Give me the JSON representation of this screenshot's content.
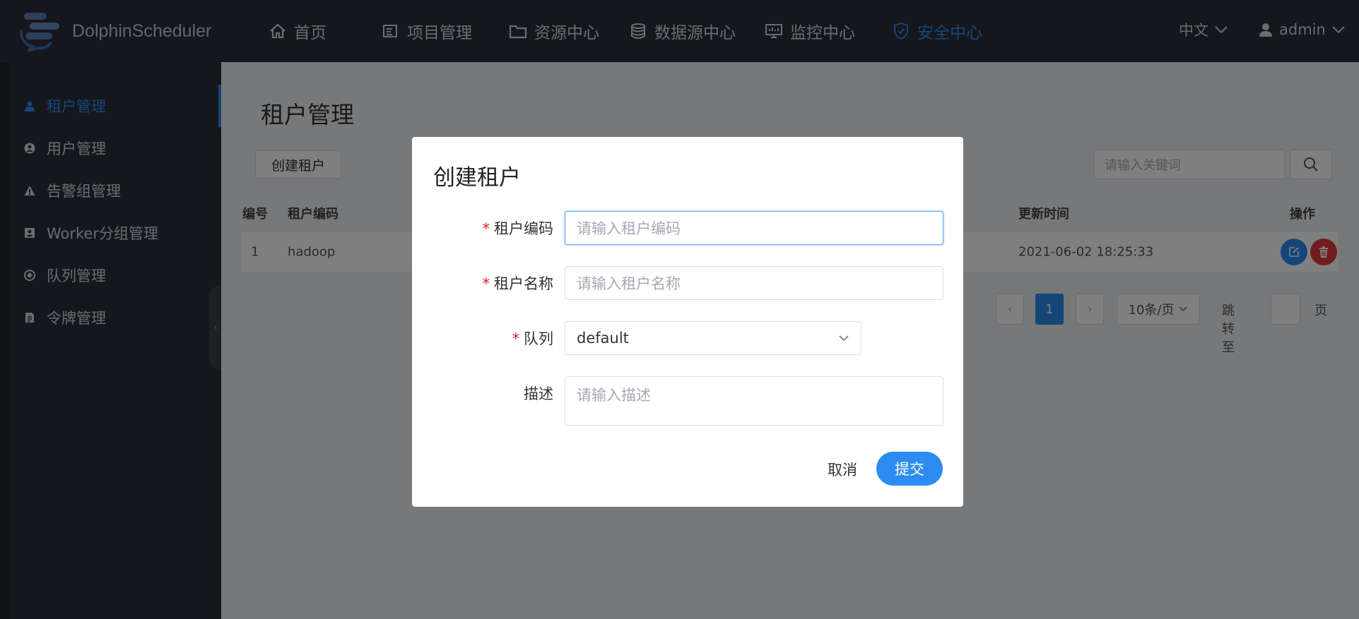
{
  "app": {
    "name": "DolphinScheduler"
  },
  "topnav": {
    "items": [
      {
        "label": "首页",
        "icon": "home-icon"
      },
      {
        "label": "项目管理",
        "icon": "project-icon"
      },
      {
        "label": "资源中心",
        "icon": "folder-icon"
      },
      {
        "label": "数据源中心",
        "icon": "database-icon"
      },
      {
        "label": "监控中心",
        "icon": "monitor-icon"
      },
      {
        "label": "安全中心",
        "icon": "shield-icon",
        "active": true
      }
    ],
    "language": "中文",
    "user": "admin"
  },
  "sidebar": {
    "items": [
      {
        "label": "租户管理",
        "icon": "user-icon",
        "active": true
      },
      {
        "label": "用户管理",
        "icon": "user-circle-icon"
      },
      {
        "label": "告警组管理",
        "icon": "warning-icon"
      },
      {
        "label": "Worker分组管理",
        "icon": "worker-icon"
      },
      {
        "label": "队列管理",
        "icon": "queue-icon"
      },
      {
        "label": "令牌管理",
        "icon": "token-icon"
      }
    ]
  },
  "main": {
    "title": "租户管理",
    "create_button": "创建租户",
    "search_placeholder": "请输入关键词",
    "table": {
      "headers": {
        "id": "编号",
        "code": "租户编码",
        "updated": "更新时间",
        "ops": "操作"
      },
      "rows": [
        {
          "id": "1",
          "code": "hadoop",
          "updated": "2021-06-02 18:25:33"
        }
      ]
    },
    "pagination": {
      "current_page": "1",
      "page_size": "10条/页",
      "jump_label": "跳转至",
      "page_suffix": "页"
    }
  },
  "modal": {
    "title": "创建租户",
    "fields": {
      "tenant_code": {
        "label": "租户编码",
        "placeholder": "请输入租户编码",
        "required": true
      },
      "tenant_name": {
        "label": "租户名称",
        "placeholder": "请输入租户名称",
        "required": true
      },
      "queue": {
        "label": "队列",
        "value": "default",
        "required": true
      },
      "description": {
        "label": "描述",
        "placeholder": "请输入描述",
        "required": false
      }
    },
    "cancel_label": "取消",
    "submit_label": "提交"
  },
  "colors": {
    "accent": "#2d8cf0",
    "danger": "#e23b3b",
    "topbar_bg": "#2b2f3a"
  }
}
